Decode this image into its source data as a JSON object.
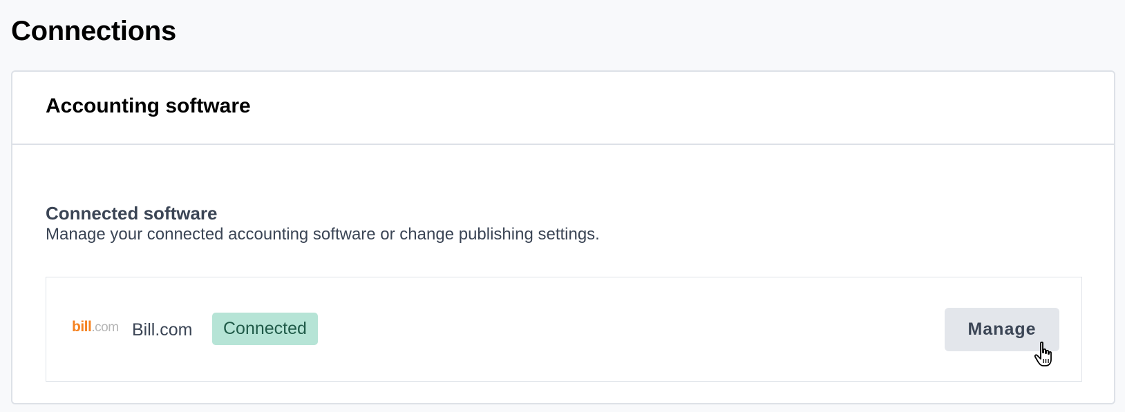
{
  "page": {
    "title": "Connections"
  },
  "card": {
    "title": "Accounting software",
    "section": {
      "title": "Connected software",
      "description": "Manage your connected accounting software or change publishing settings."
    },
    "integration": {
      "logo_primary": "bill",
      "logo_secondary": ".com",
      "name": "Bill.com",
      "status": "Connected",
      "status_color": "#b6e4d6",
      "action_label": "Manage"
    }
  },
  "cursor": {
    "icon": "hand-pointer-icon"
  }
}
